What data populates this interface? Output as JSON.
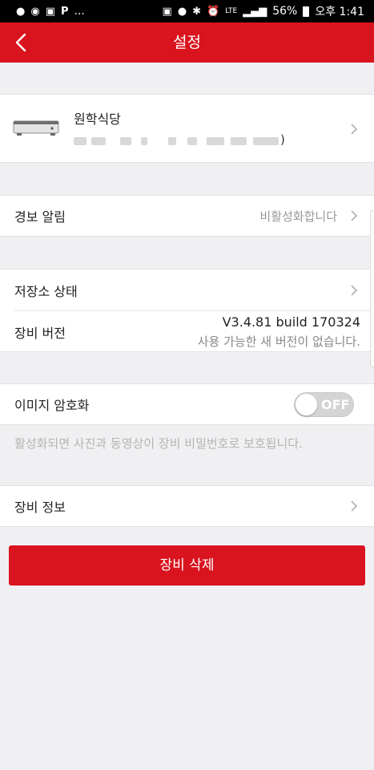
{
  "status_bar": {
    "left_icons": [
      "app-icon-1",
      "app-icon-2",
      "talk-icon",
      "p-icon"
    ],
    "ellipsis": "...",
    "network": "LTE",
    "battery": "56%",
    "time": "오후 1:41"
  },
  "header": {
    "title": "설정",
    "accent_color": "#d9141e"
  },
  "device": {
    "name": "원학식당",
    "serial_suffix": ")"
  },
  "alarm": {
    "label": "경보 알림",
    "value": "비활성화합니다"
  },
  "storage": {
    "label": "저장소 상태"
  },
  "version": {
    "label": "장비 버전",
    "value": "V3.4.81 build 170324",
    "note": "사용 가능한 새 버전이 없습니다."
  },
  "encryption": {
    "label": "이미지 암호화",
    "toggle_text": "OFF",
    "toggle_on": false,
    "hint": "활성화되면 사진과 동영상이 장비 비밀번호로 보호됩니다."
  },
  "device_info": {
    "label": "장비 정보"
  },
  "delete_button": {
    "label": "장비 삭제"
  }
}
